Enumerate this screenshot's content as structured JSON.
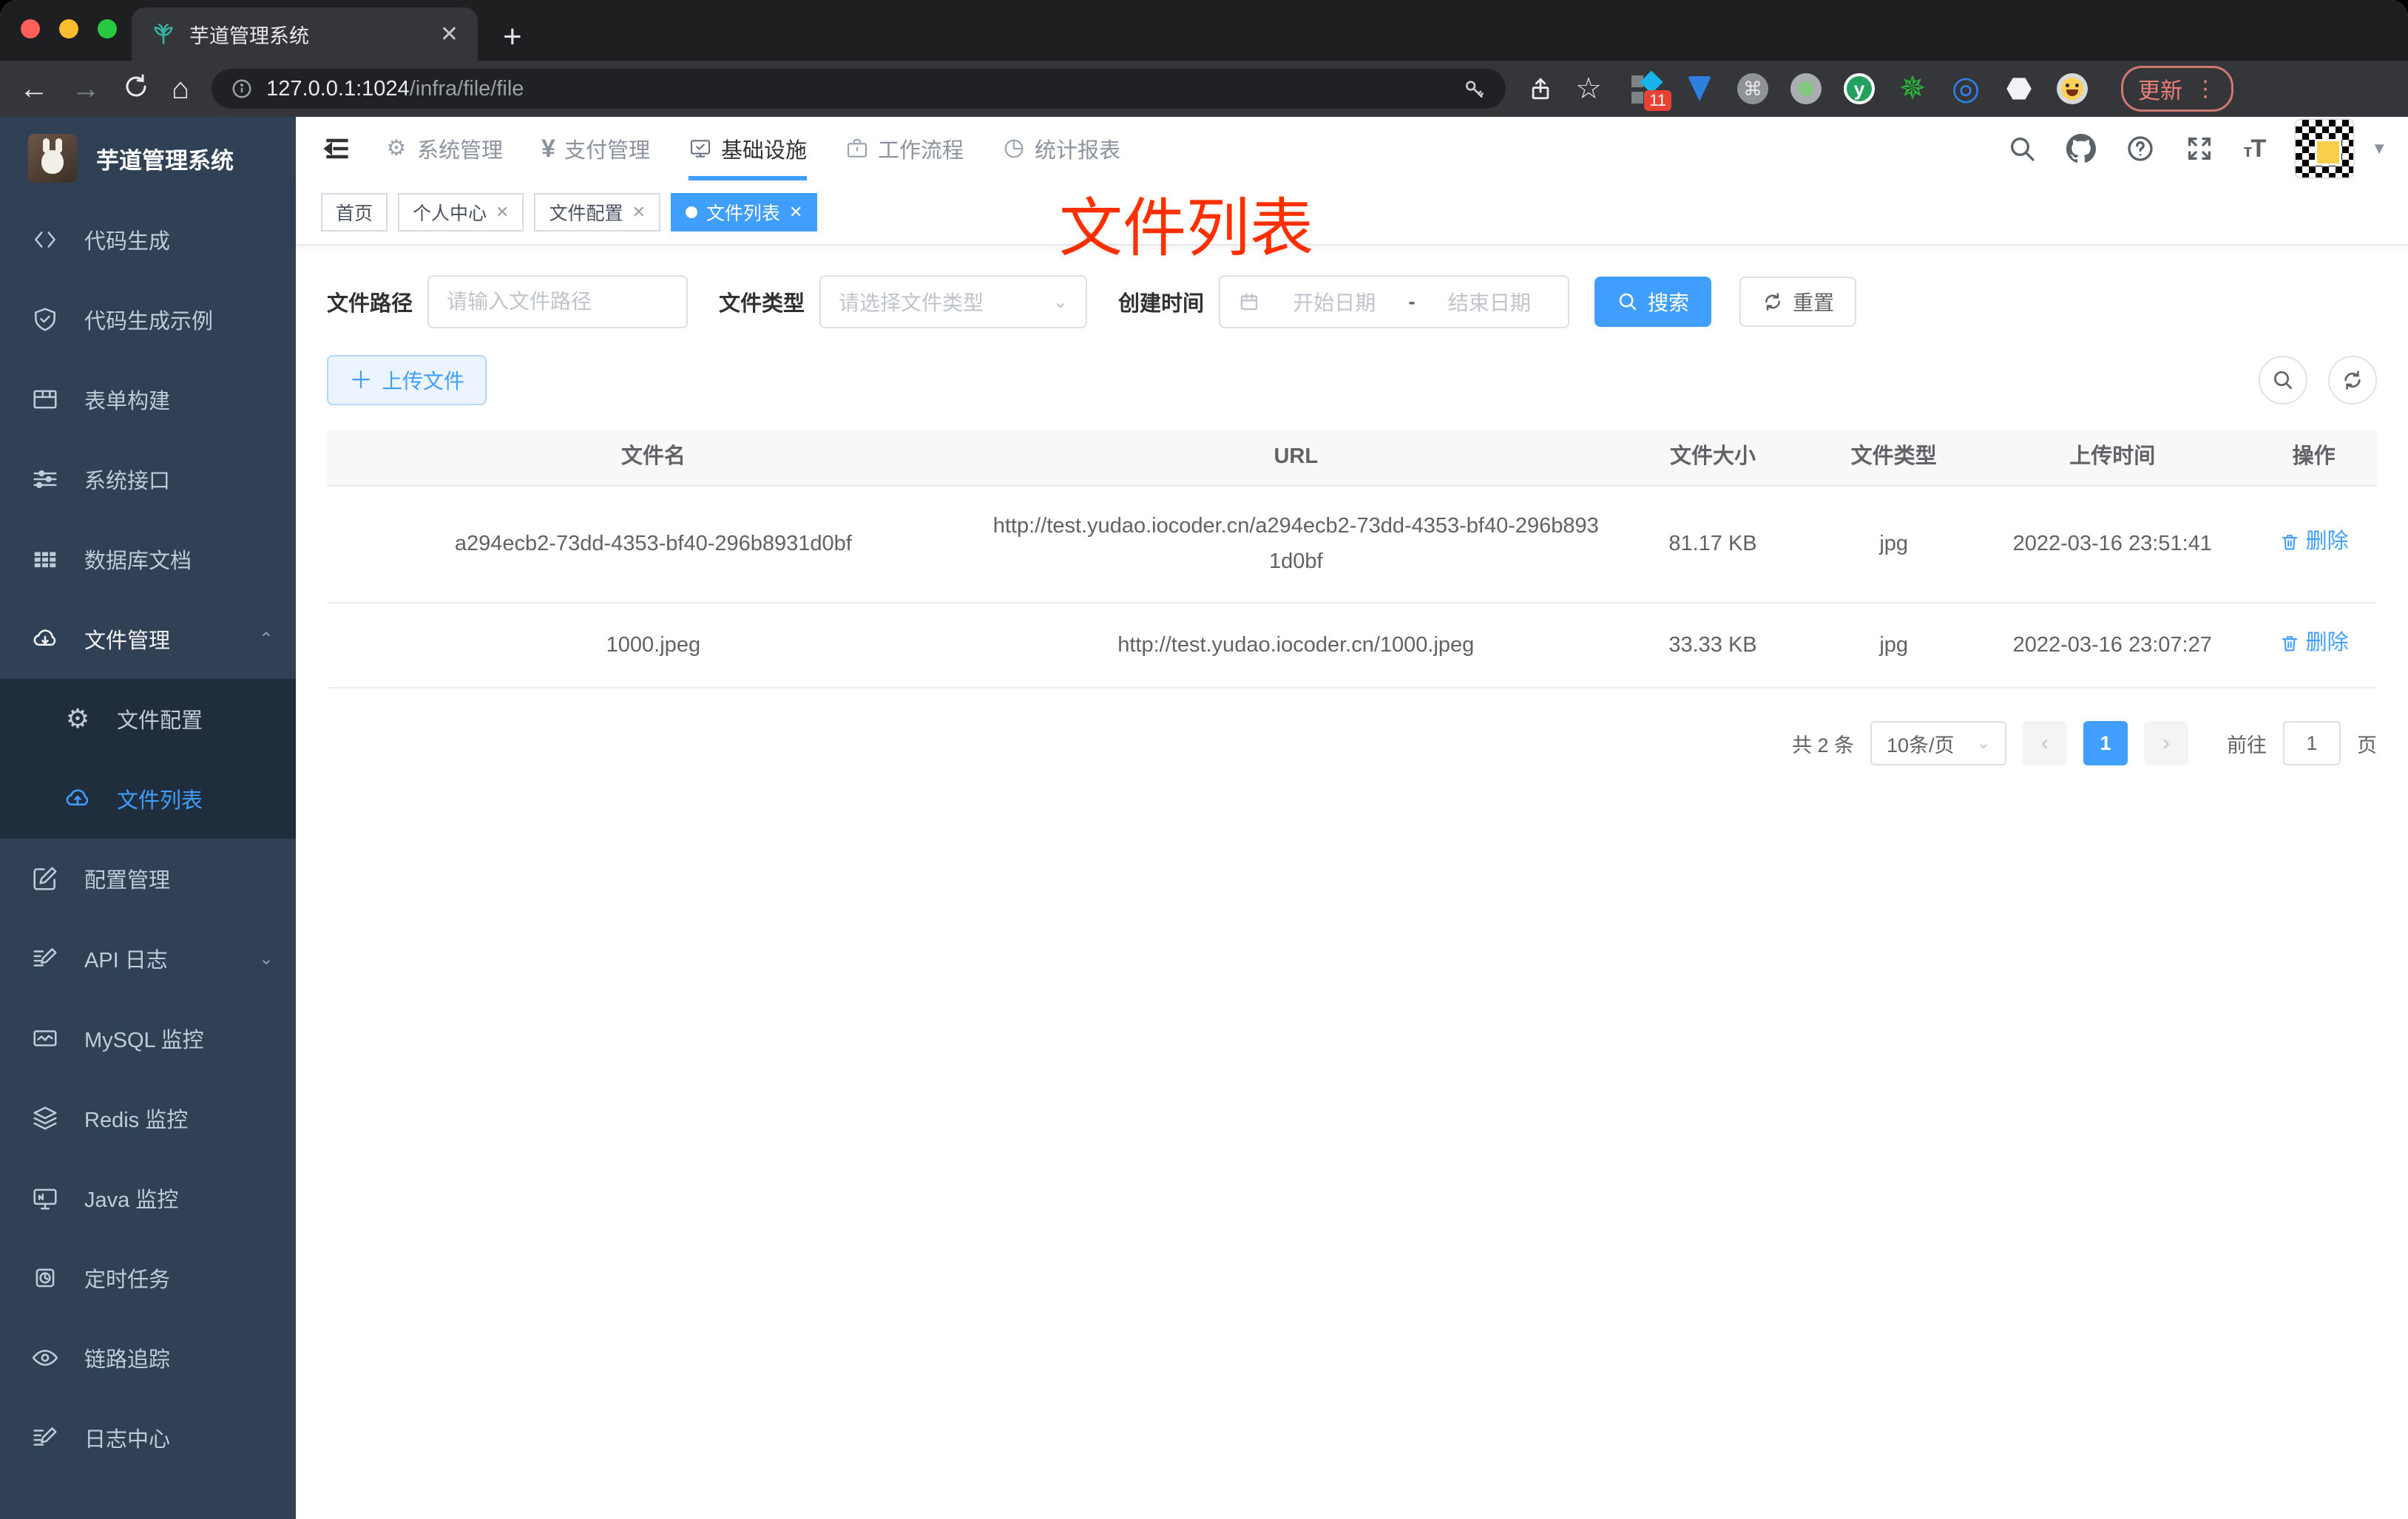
{
  "browser": {
    "tab_title": "芋道管理系统",
    "url_host": "127.0.0.1:1024",
    "url_path": "/infra/file/file",
    "extension_badge": "11",
    "update_label": "更新"
  },
  "sidebar": {
    "logo_title": "芋道管理系统",
    "items": [
      {
        "label": "代码生成"
      },
      {
        "label": "代码生成示例"
      },
      {
        "label": "表单构建"
      },
      {
        "label": "系统接口"
      },
      {
        "label": "数据库文档"
      },
      {
        "label": "文件管理"
      },
      {
        "label": "文件配置"
      },
      {
        "label": "文件列表"
      },
      {
        "label": "配置管理"
      },
      {
        "label": "API 日志"
      },
      {
        "label": "MySQL 监控"
      },
      {
        "label": "Redis 监控"
      },
      {
        "label": "Java 监控"
      },
      {
        "label": "定时任务"
      },
      {
        "label": "链路追踪"
      },
      {
        "label": "日志中心"
      }
    ]
  },
  "topnav": {
    "items": [
      {
        "label": "系统管理"
      },
      {
        "label": "支付管理"
      },
      {
        "label": "基础设施"
      },
      {
        "label": "工作流程"
      },
      {
        "label": "统计报表"
      }
    ]
  },
  "view_tabs": [
    {
      "label": "首页"
    },
    {
      "label": "个人中心"
    },
    {
      "label": "文件配置"
    },
    {
      "label": "文件列表"
    }
  ],
  "annotation": "文件列表",
  "filters": {
    "path_label": "文件路径",
    "path_placeholder": "请输入文件路径",
    "type_label": "文件类型",
    "type_placeholder": "请选择文件类型",
    "date_label": "创建时间",
    "date_start": "开始日期",
    "date_separator": "-",
    "date_end": "结束日期",
    "search_label": "搜索",
    "reset_label": "重置"
  },
  "actions": {
    "upload_label": "上传文件"
  },
  "table": {
    "headers": [
      "文件名",
      "URL",
      "文件大小",
      "文件类型",
      "上传时间",
      "操作"
    ],
    "rows": [
      {
        "name": "a294ecb2-73dd-4353-bf40-296b8931d0bf",
        "url": "http://test.yudao.iocoder.cn/a294ecb2-73dd-4353-bf40-296b8931d0bf",
        "size": "81.17 KB",
        "type": "jpg",
        "time": "2022-03-16 23:51:41",
        "action": "删除"
      },
      {
        "name": "1000.jpeg",
        "url": "http://test.yudao.iocoder.cn/1000.jpeg",
        "size": "33.33 KB",
        "type": "jpg",
        "time": "2022-03-16 23:07:27",
        "action": "删除"
      }
    ]
  },
  "pagination": {
    "total": "共 2 条",
    "per_page": "10条/页",
    "current_page": "1",
    "goto_label": "前往",
    "goto_value": "1",
    "goto_unit": "页"
  },
  "colors": {
    "primary": "#409eff",
    "sidebar_bg": "#304156",
    "submenu_bg": "#1f2d3d",
    "annotation": "#ff2f00"
  }
}
